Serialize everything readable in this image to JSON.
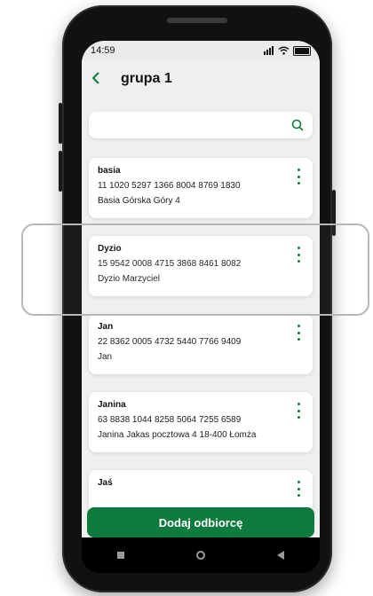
{
  "status_bar": {
    "time": "14:59",
    "signal_icon": "signal-icon",
    "wifi_icon": "wifi-icon",
    "battery_icon": "battery-icon"
  },
  "header": {
    "back_icon": "chevron-left-icon",
    "title": "grupa 1"
  },
  "search": {
    "placeholder": "",
    "value": "",
    "icon": "search-icon"
  },
  "recipients": [
    {
      "name": "basia",
      "account": "11 1020 5297 1366 8004 8769 1830",
      "details": "Basia Górska Góry 4"
    },
    {
      "name": "Dyzio",
      "account": "15 9542 0008 4715 3868 8461 8082",
      "details": "Dyzio Marzyciel"
    },
    {
      "name": "Jan",
      "account": "22 8362 0005 4732 5440 7766 9409",
      "details": "Jan"
    },
    {
      "name": "Janina",
      "account": "63 8838 1044 8258 5064 7255 6589",
      "details": "Janina Jakas  pocztowa 4 18-400 Łomża"
    },
    {
      "name": "Jaś",
      "account": "",
      "details": ""
    }
  ],
  "actions": {
    "add_recipient": "Dodaj odbiorcę"
  },
  "colors": {
    "accent": "#0f7a3d",
    "screen_bg": "#eef0ef",
    "card_bg": "#ffffff"
  }
}
